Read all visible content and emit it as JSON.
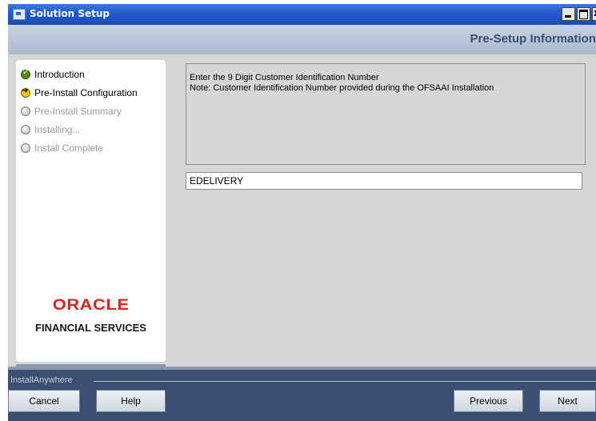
{
  "window": {
    "title": "Solution Setup"
  },
  "header": {
    "title": "Pre-Setup Information"
  },
  "steps": [
    {
      "label": "Introduction",
      "state": "done",
      "icon": "check-circle-icon"
    },
    {
      "label": "Pre-Install Configuration",
      "state": "current",
      "icon": "arrow-circle-icon"
    },
    {
      "label": "Pre-Install Summary",
      "state": "pending",
      "icon": "empty-circle-icon"
    },
    {
      "label": "Installing...",
      "state": "pending",
      "icon": "empty-circle-icon"
    },
    {
      "label": "Install Complete",
      "state": "pending",
      "icon": "empty-circle-icon"
    }
  ],
  "logo": {
    "brand": "ORACLE",
    "subtitle": "FINANCIAL SERVICES"
  },
  "main": {
    "instruction": "Enter the 9 Digit Customer Identification Number",
    "note": "Note: Customer Identification Number provided during the OFSAAI Installation",
    "input_value": "EDELIVERY"
  },
  "footer": {
    "brand": "InstallAnywhere",
    "cancel_label": "Cancel",
    "help_label": "Help",
    "previous_label": "Previous",
    "next_label": "Next"
  },
  "colors": {
    "titlebar": "#2359c8",
    "header_text": "#3b4f72",
    "footer_bg": "#3b4f72",
    "oracle_red": "#e2231a"
  }
}
